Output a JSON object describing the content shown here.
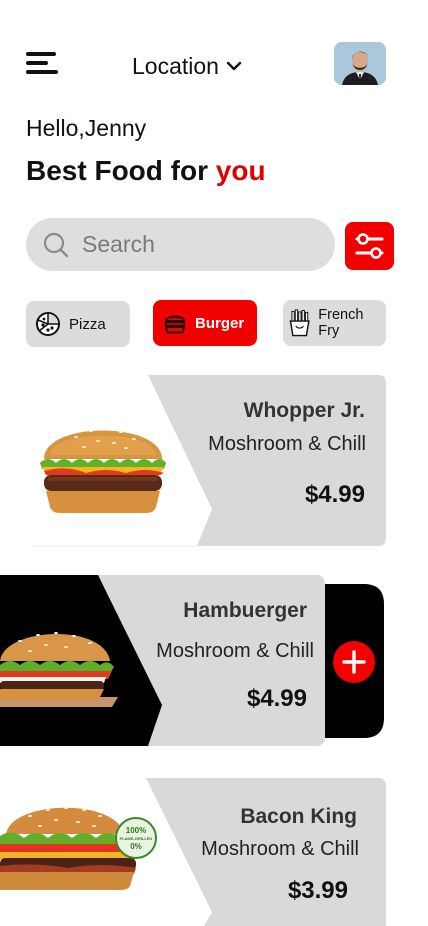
{
  "header": {
    "location_label": "Location",
    "menu_icon": "hamburger-menu-icon",
    "avatar_icon": "user-avatar"
  },
  "greeting": "Hello,Jenny",
  "headline": {
    "prefix": "Best Food for ",
    "accent": "you",
    "accent_color": "#e00000"
  },
  "search": {
    "placeholder": "Search"
  },
  "categories": [
    {
      "label": "Pizza",
      "icon": "pizza-icon",
      "selected": false
    },
    {
      "label": "Burger",
      "icon": "burger-icon",
      "selected": true
    },
    {
      "label": "French Fry",
      "icon": "french-fries-icon",
      "selected": false
    }
  ],
  "foods": [
    {
      "name": "Whopper Jr.",
      "description": "Moshroom & Chill",
      "price": "$4.99"
    },
    {
      "name": "Hambuerger",
      "description": "Moshroom & Chill",
      "price": "$4.99"
    },
    {
      "name": "Bacon King",
      "description": "Moshroom & Chill",
      "price": "$3.99"
    }
  ],
  "badge_text": {
    "line1": "100%",
    "line2": "FLAME-GRILLED",
    "line3": "0%"
  },
  "colors": {
    "accent": "#f20000",
    "card_bg": "#d9d9d9"
  }
}
